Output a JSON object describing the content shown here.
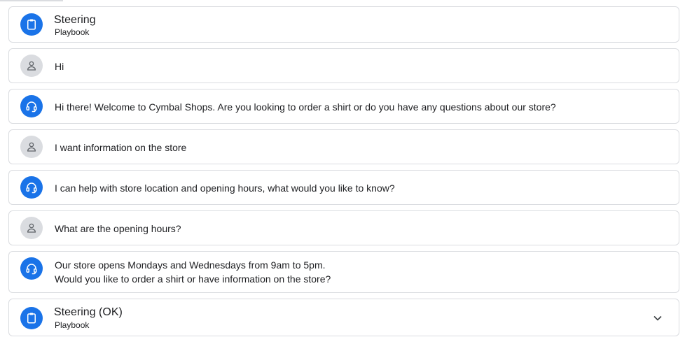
{
  "steps": [
    {
      "kind": "playbook",
      "title": "Steering",
      "subtitle": "Playbook"
    },
    {
      "kind": "user",
      "text": "Hi"
    },
    {
      "kind": "agent",
      "text": "Hi there! Welcome to Cymbal Shops. Are you looking to order a shirt or do you have any questions about our store?"
    },
    {
      "kind": "user",
      "text": "I want information on the store"
    },
    {
      "kind": "agent",
      "text": "I can help with store location and opening hours, what would you like to know?"
    },
    {
      "kind": "user",
      "text": "What are the opening hours?"
    },
    {
      "kind": "agent",
      "lines": [
        "Our store opens Mondays and Wednesdays from 9am to 5pm.",
        "Would you like to order a shirt or have information on the store?"
      ]
    },
    {
      "kind": "playbook",
      "title": "Steering (OK)",
      "subtitle": "Playbook",
      "expand_icon": "chevron-down-icon"
    }
  ],
  "colors": {
    "agent_avatar": "#1a73e8",
    "user_avatar": "#dadce0",
    "border": "#dadce0"
  },
  "icons": {
    "playbook": "clipboard-icon",
    "user": "person-icon",
    "agent": "headset-icon"
  }
}
